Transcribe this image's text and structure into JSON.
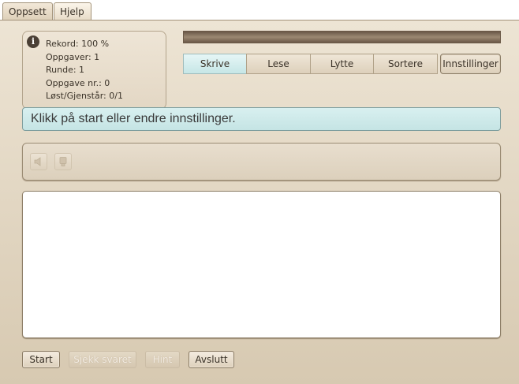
{
  "menu": {
    "tabs": [
      {
        "label": "Oppsett"
      },
      {
        "label": "Hjelp"
      }
    ]
  },
  "info": {
    "lines": [
      "Rekord: 100 %",
      "Oppgaver: 1",
      "Runde: 1",
      "Oppgave nr.: 0",
      "Løst/Gjenstår: 0/1"
    ],
    "icon": "info-icon"
  },
  "modes": {
    "tabs": [
      "Skrive",
      "Lese",
      "Lytte",
      "Sortere",
      "Innstillinger"
    ],
    "active": "Skrive"
  },
  "instruction": "Klikk på start eller endre innstillinger.",
  "toolbar": {
    "icons": [
      "speaker-icon",
      "lamp-icon"
    ]
  },
  "answer": {
    "value": ""
  },
  "buttons": {
    "start": "Start",
    "check": "Sjekk svaret",
    "hint": "Hint",
    "quit": "Avslutt"
  },
  "colors": {
    "accent": "#c6e6e6",
    "background": "#e2d6c2"
  }
}
